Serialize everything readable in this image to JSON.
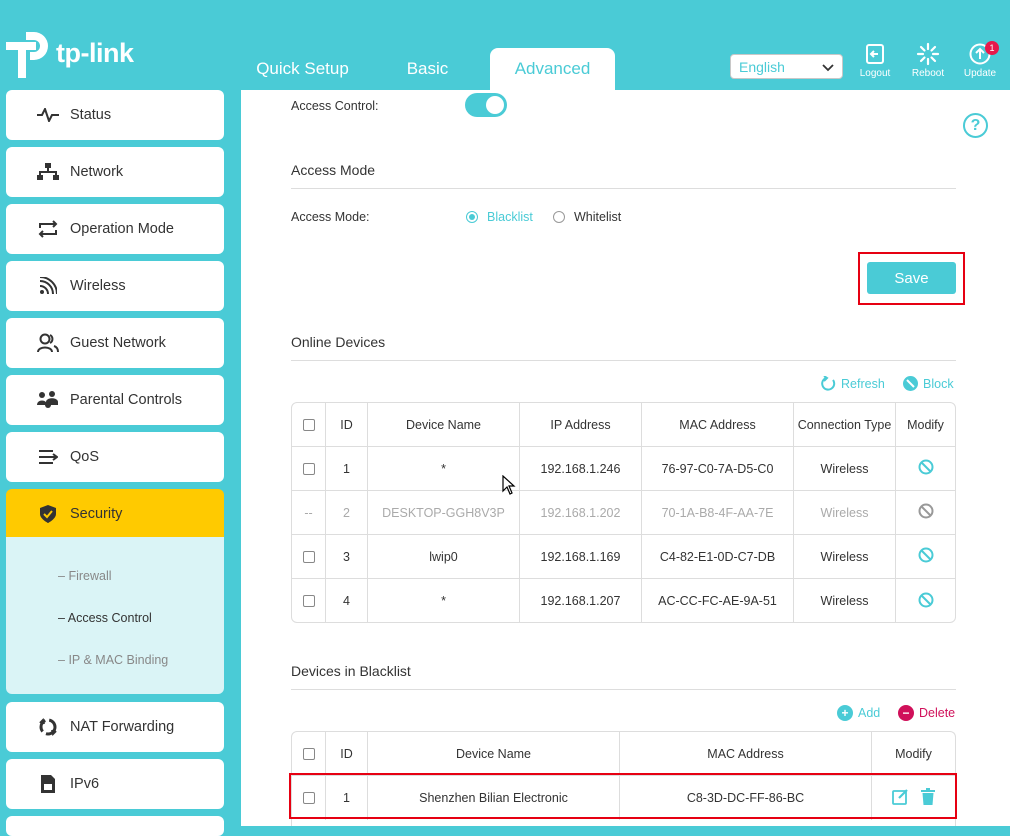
{
  "brand": {
    "name": "tp-link"
  },
  "tabs": [
    {
      "label": "Quick Setup"
    },
    {
      "label": "Basic"
    },
    {
      "label": "Advanced",
      "active": true
    }
  ],
  "language": {
    "selected": "English"
  },
  "tools": [
    {
      "label": "Logout",
      "icon": "logout-icon"
    },
    {
      "label": "Reboot",
      "icon": "reboot-icon"
    },
    {
      "label": "Update",
      "icon": "update-icon",
      "badge": "1"
    }
  ],
  "sidebar": {
    "items": [
      {
        "label": "Status",
        "icon": "pulse-icon"
      },
      {
        "label": "Network",
        "icon": "network-icon"
      },
      {
        "label": "Operation Mode",
        "icon": "operation-mode-icon"
      },
      {
        "label": "Wireless",
        "icon": "wifi-icon"
      },
      {
        "label": "Guest Network",
        "icon": "guest-icon"
      },
      {
        "label": "Parental Controls",
        "icon": "parental-icon"
      },
      {
        "label": "QoS",
        "icon": "qos-icon"
      },
      {
        "label": "Security",
        "icon": "shield-icon",
        "active": true
      },
      {
        "label": "NAT Forwarding",
        "icon": "nat-icon"
      },
      {
        "label": "IPv6",
        "icon": "ipv6-icon"
      }
    ],
    "sub_items": [
      {
        "label": "Firewall"
      },
      {
        "label": "Access Control",
        "active": true
      },
      {
        "label": "IP & MAC Binding"
      }
    ]
  },
  "access_control": {
    "label": "Access Control:",
    "enabled": true
  },
  "access_mode": {
    "section_title": "Access Mode",
    "label": "Access Mode:",
    "options": [
      {
        "label": "Blacklist",
        "selected": true
      },
      {
        "label": "Whitelist",
        "selected": false
      }
    ],
    "save_label": "Save"
  },
  "online_devices": {
    "section_title": "Online Devices",
    "refresh_label": "Refresh",
    "block_label": "Block",
    "headers": [
      "ID",
      "Device Name",
      "IP Address",
      "MAC Address",
      "Connection Type",
      "Modify"
    ],
    "rows": [
      {
        "id": "1",
        "name": "*",
        "ip": "192.168.1.246",
        "mac": "76-97-C0-7A-D5-C0",
        "type": "Wireless",
        "disabled": false
      },
      {
        "id": "2",
        "name": "DESKTOP-GGH8V3P",
        "ip": "192.168.1.202",
        "mac": "70-1A-B8-4F-AA-7E",
        "type": "Wireless",
        "disabled": true
      },
      {
        "id": "3",
        "name": "lwip0",
        "ip": "192.168.1.169",
        "mac": "C4-82-E1-0D-C7-DB",
        "type": "Wireless",
        "disabled": false
      },
      {
        "id": "4",
        "name": "*",
        "ip": "192.168.1.207",
        "mac": "AC-CC-FC-AE-9A-51",
        "type": "Wireless",
        "disabled": false
      }
    ],
    "disabled_marker": "--"
  },
  "blacklist": {
    "section_title": "Devices in Blacklist",
    "add_label": "Add",
    "delete_label": "Delete",
    "headers": [
      "ID",
      "Device Name",
      "MAC Address",
      "Modify"
    ],
    "rows": [
      {
        "id": "1",
        "name": "Shenzhen Bilian Electronic",
        "mac": "C8-3D-DC-FF-86-BC"
      }
    ]
  },
  "colors": {
    "accent": "#4acbd6",
    "active_nav": "#ffca00",
    "highlight": "#e60012",
    "delete": "#d0105a"
  }
}
